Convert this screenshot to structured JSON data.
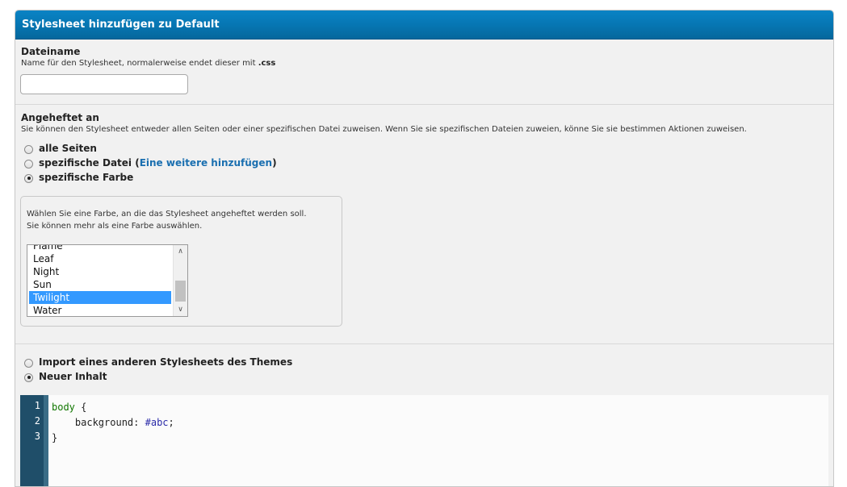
{
  "panel": {
    "title": "Stylesheet hinzufügen zu Default"
  },
  "filename": {
    "label": "Dateiname",
    "desc_prefix": "Name für den Stylesheet, normalerweise endet dieser mit ",
    "desc_ext": ".css",
    "value": "",
    "placeholder": ""
  },
  "attached": {
    "label": "Angeheftet an",
    "desc": "Sie können den Stylesheet entweder allen Seiten oder einer spezifischen Datei zuweisen. Wenn Sie sie spezifischen Dateien zuweien, könne Sie sie bestimmen Aktionen zuweisen.",
    "options": [
      {
        "label": "alle Seiten",
        "checked": false
      },
      {
        "label_prefix": "spezifische Datei (",
        "link": "Eine weitere hinzufügen",
        "label_suffix": ")",
        "checked": false
      },
      {
        "label": "spezifische Farbe",
        "checked": true
      }
    ],
    "color_hint": "Wählen Sie eine Farbe, an die das Stylesheet angeheftet werden soll. Sie können mehr als eine Farbe auswählen.",
    "colors": [
      "Flame",
      "Leaf",
      "Night",
      "Sun",
      "Twilight",
      "Water"
    ],
    "selected_color": "Twilight"
  },
  "content": {
    "options": [
      {
        "label": "Import eines anderen Stylesheets des Themes",
        "checked": false
      },
      {
        "label": "Neuer Inhalt",
        "checked": true
      }
    ]
  },
  "editor": {
    "line_numbers": [
      "1",
      "2",
      "3"
    ],
    "lines": [
      {
        "selector": "body",
        "rest": " {"
      },
      {
        "indent": "    ",
        "property": "background:",
        "value": "#abc",
        "end": ";"
      },
      {
        "text": "}"
      }
    ]
  },
  "colors": {
    "header_bg": "#0675b1",
    "link": "#1a6fb0",
    "selection": "#3399ff",
    "gutter": "#1f4e69"
  }
}
